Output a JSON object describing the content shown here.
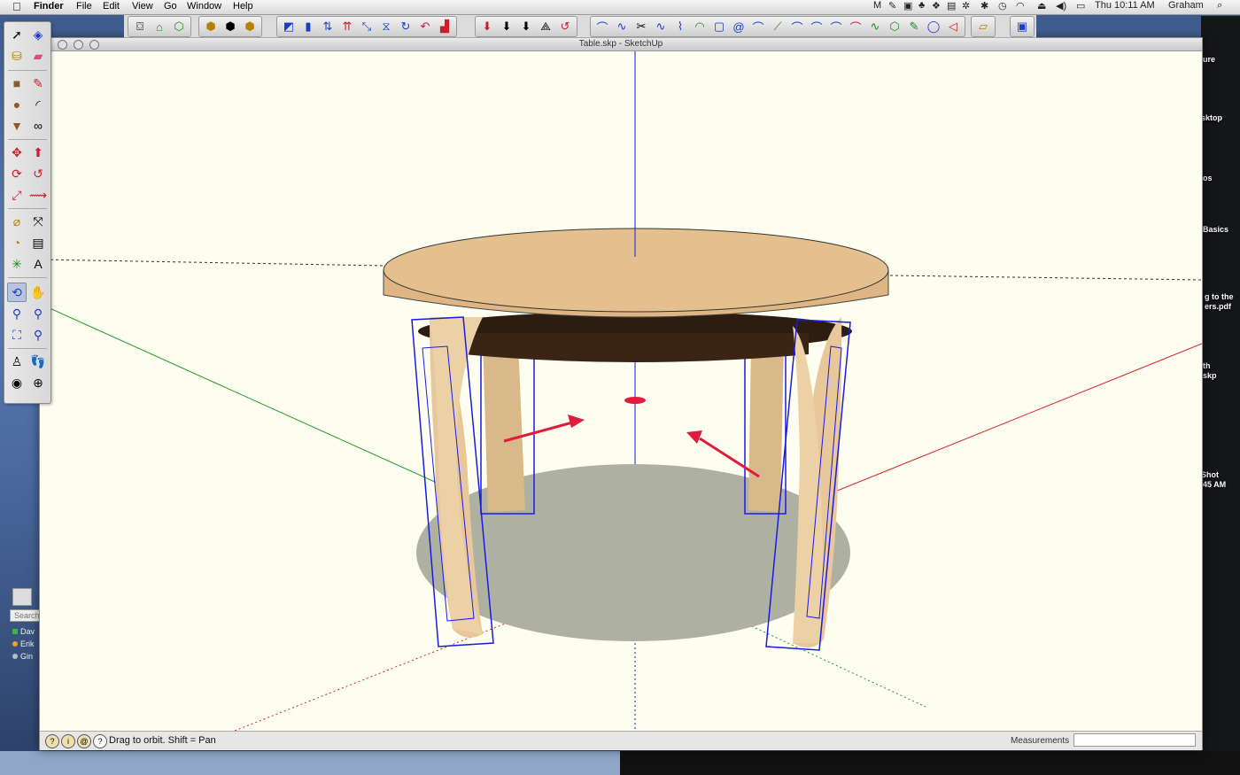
{
  "menubar": {
    "app": "Finder",
    "items": [
      "File",
      "Edit",
      "View",
      "Go",
      "Window",
      "Help"
    ],
    "clock": "Thu 10:11 AM",
    "user": "Graham"
  },
  "window": {
    "title": "Table.skp - SketchUp"
  },
  "statusbar": {
    "hint": "Drag to orbit.  Shift = Pan",
    "measurements_label": "Measurements",
    "measurements_value": ""
  },
  "desktop": {
    "icon_labels": [
      "ure",
      "sktop",
      "os",
      "Basics",
      "g to the",
      "ers.pdf",
      "th",
      "skp",
      "Shot",
      "45 AM"
    ]
  },
  "chat": {
    "search_placeholder": "Search",
    "contacts": [
      "Dav",
      "Erik",
      "Gin"
    ],
    "contact_status_colors": [
      "#3ab44a",
      "#f0a020",
      "#bdbdbd"
    ]
  },
  "colors": {
    "viewport_bg": "#fdfdf0",
    "axis_red": "#d8202a",
    "axis_green": "#1f9a2a",
    "axis_blue": "#1020d8",
    "selection_blue": "#1a1ae6",
    "tabletop": "#e3c08e",
    "leg": "#e8c79a",
    "shadow": "#aeb0a2",
    "apron": "#3a2414",
    "arrow": "#e01c3c"
  }
}
